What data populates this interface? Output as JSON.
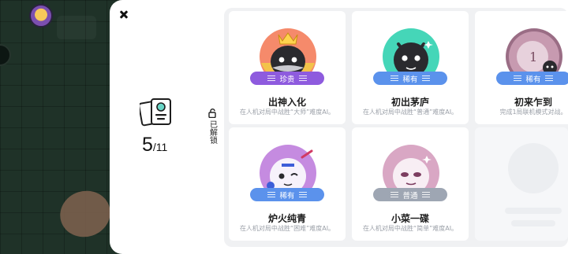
{
  "dialog": {
    "close_icon": "close-icon",
    "progress": {
      "current": "5",
      "total": "/11"
    },
    "unlocked_label": "已解锁"
  },
  "achievements": [
    {
      "title": "出神入化",
      "rarity": "珍贵",
      "rarity_color": "#8e5bde",
      "description": "在人机对局中战胜“大师”难度AI。"
    },
    {
      "title": "初出茅庐",
      "rarity": "稀有",
      "rarity_color": "#5b92ec",
      "description": "在人机对局中战胜“普通”难度AI。"
    },
    {
      "title": "初来乍到",
      "rarity": "稀有",
      "rarity_color": "#5b92ec",
      "description": "完成1局联机模式对战。"
    },
    {
      "title": "炉火纯青",
      "rarity": "稀有",
      "rarity_color": "#5b92ec",
      "description": "在人机对局中战胜“困难”难度AI。"
    },
    {
      "title": "小菜一碟",
      "rarity": "普通",
      "rarity_color": "#9ea6b3",
      "description": "在人机对局中战胜“简单”难度AI。"
    }
  ]
}
